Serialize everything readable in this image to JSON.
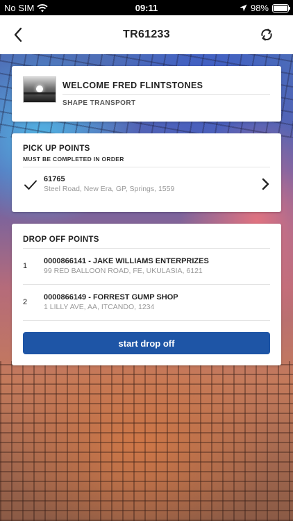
{
  "status_bar": {
    "carrier": "No SIM",
    "time": "09:11",
    "battery": "98%",
    "battery_level": 0.98
  },
  "nav": {
    "title": "TR61233"
  },
  "welcome": {
    "title": "WELCOME FRED FLINTSTONES",
    "subtitle": "SHAPE TRANSPORT"
  },
  "pickup": {
    "heading": "PICK UP POINTS",
    "subheading": "MUST BE COMPLETED IN ORDER",
    "items": [
      {
        "id": "61765",
        "address": "Steel Road, New Era, GP, Springs, 1559",
        "completed": true
      }
    ]
  },
  "dropoff": {
    "heading": "DROP OFF POINTS",
    "items": [
      {
        "index": "1",
        "name": "0000866141 - JAKE WILLIAMS ENTERPRIZES",
        "address": "99 RED BALLOON ROAD, FE, UKULASIA, 6121"
      },
      {
        "index": "2",
        "name": "0000866149 - FORREST GUMP SHOP",
        "address": "1 LILLY AVE, AA, ITCANDO, 1234"
      }
    ],
    "button_label": "start drop off"
  },
  "colors": {
    "primary_button": "#1e55a6"
  }
}
